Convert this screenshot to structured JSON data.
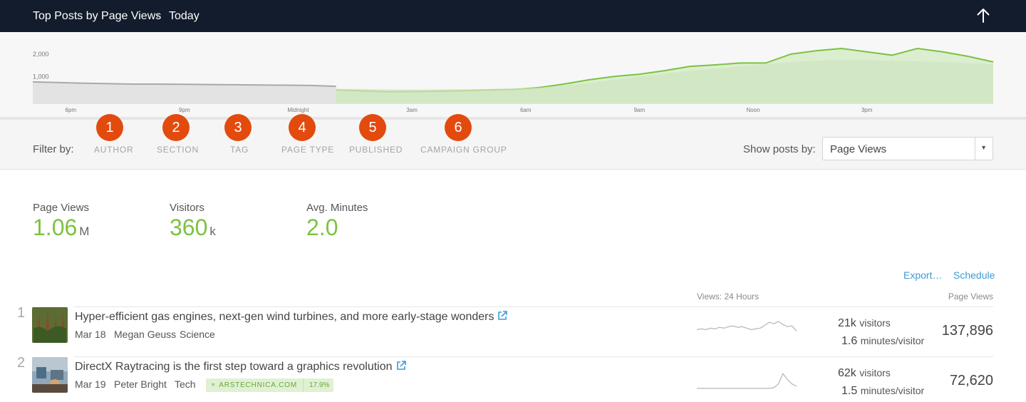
{
  "header": {
    "breadcrumb_root": "Top Posts by Page Views",
    "breadcrumb_current": "Today"
  },
  "chart_data": {
    "type": "area",
    "x_ticks": [
      "6pm",
      "9pm",
      "Midnight",
      "3am",
      "6am",
      "9am",
      "Noon",
      "3pm"
    ],
    "y_ticks": [
      "2,000",
      "1,000"
    ],
    "ylim": [
      0,
      2800
    ],
    "series": [
      {
        "style": "previous-period-grey",
        "x": [
          0,
          2,
          4,
          6,
          8,
          10,
          12,
          14,
          16,
          18,
          20,
          22,
          24
        ],
        "y": [
          960,
          930,
          900,
          880,
          860,
          860,
          850,
          840,
          830,
          820,
          810,
          800,
          760
        ]
      },
      {
        "style": "current-green",
        "x": [
          24,
          26,
          28,
          30,
          32,
          34,
          36,
          38,
          40,
          42,
          44,
          46,
          48,
          50,
          52,
          54,
          56,
          58,
          60,
          62,
          64,
          66,
          68,
          70,
          72,
          74,
          76
        ],
        "y": [
          600,
          560,
          520,
          530,
          540,
          560,
          600,
          620,
          700,
          860,
          1050,
          1200,
          1300,
          1460,
          1650,
          1720,
          1800,
          1800,
          2200,
          2350,
          2450,
          2300,
          2150,
          2450,
          2300,
          2100,
          1850
        ]
      },
      {
        "style": "comparison-fill",
        "x": [
          24,
          30,
          36,
          40,
          44,
          48,
          52,
          56,
          60,
          64,
          68,
          72,
          76
        ],
        "y": [
          650,
          620,
          640,
          700,
          900,
          1200,
          1450,
          1650,
          1850,
          1950,
          1900,
          1850,
          1750
        ]
      }
    ]
  },
  "filters": {
    "label": "Filter by:",
    "items": [
      {
        "label": "AUTHOR",
        "badge": "1"
      },
      {
        "label": "SECTION",
        "badge": "2"
      },
      {
        "label": "TAG",
        "badge": "3"
      },
      {
        "label": "PAGE TYPE",
        "badge": "4"
      },
      {
        "label": "PUBLISHED",
        "badge": "5"
      },
      {
        "label": "CAMPAIGN GROUP",
        "badge": "6"
      }
    ],
    "show_label": "Show posts by:",
    "show_value": "Page Views"
  },
  "metrics": [
    {
      "label": "Page Views",
      "value": "1.06",
      "unit": "M"
    },
    {
      "label": "Visitors",
      "value": "360",
      "unit": "k"
    },
    {
      "label": "Avg. Minutes",
      "value": "2.0",
      "unit": ""
    }
  ],
  "actions": {
    "export": "Export…",
    "schedule": "Schedule"
  },
  "table": {
    "col_views24": "Views: 24 Hours",
    "col_pageviews": "Page Views",
    "rows": [
      {
        "rank": "1",
        "title": "Hyper-efficient gas engines, next-gen wind turbines, and more early-stage wonders",
        "date": "Mar 18",
        "author": "Megan Geuss",
        "section": "Science",
        "visitors_num": "21k",
        "visitors_unit": "visitors",
        "minutes_num": "1.6",
        "minutes_unit": "minutes/visitor",
        "pageviews": "137,896",
        "spark": [
          14,
          15,
          14,
          16,
          15,
          17,
          16,
          18,
          19,
          17,
          18,
          16,
          14,
          15,
          16,
          20,
          24,
          22,
          25,
          21,
          18,
          19,
          12
        ]
      },
      {
        "rank": "2",
        "title": "DirectX Raytracing is the first step toward a graphics revolution",
        "date": "Mar 19",
        "author": "Peter Bright",
        "section": "Tech",
        "domain": "ARSTECHNICA.COM",
        "domain_pct": "17.9%",
        "visitors_num": "62k",
        "visitors_unit": "visitors",
        "minutes_num": "1.5",
        "minutes_unit": "minutes/visitor",
        "pageviews": "72,620",
        "spark": [
          2,
          2,
          2,
          2,
          2,
          2,
          2,
          2,
          2,
          2,
          2,
          2,
          2,
          2,
          2,
          2,
          2,
          3,
          8,
          22,
          14,
          8,
          5
        ]
      }
    ]
  }
}
